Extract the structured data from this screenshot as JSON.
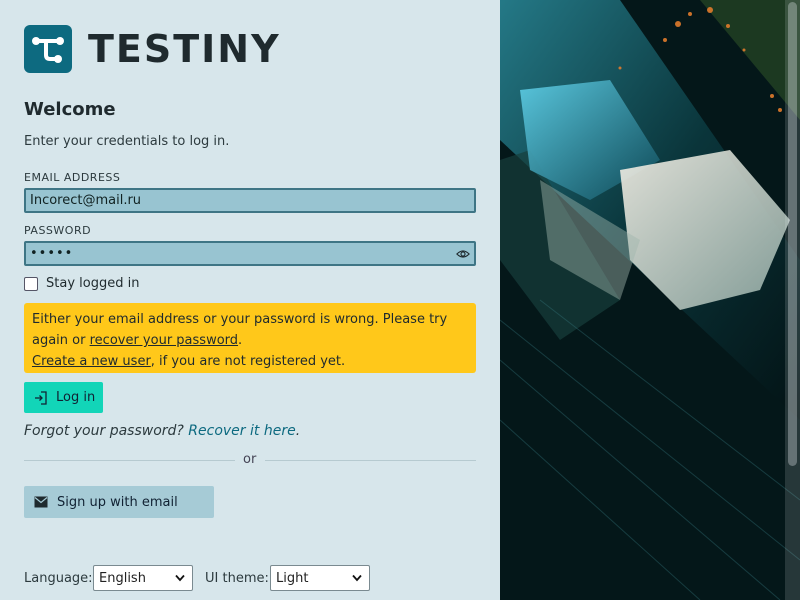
{
  "brand": {
    "name": "TESTINY",
    "logo_color": "#0d6a80"
  },
  "login": {
    "title": "Welcome",
    "subtitle": "Enter your credentials to log in.",
    "email_label": "EMAIL ADDRESS",
    "email_value": "Incorect@mail.ru",
    "password_label": "PASSWORD",
    "password_value": "•••••",
    "stay_logged_in_label": "Stay logged in",
    "stay_logged_in_checked": false
  },
  "error": {
    "text_1": "Either your email address or your password is wrong. Please try again or ",
    "recover_link": "recover your password",
    "text_2": ".",
    "create_link": "Create a new user",
    "text_3": ", if you are not registered yet.",
    "color": "#ffc81a"
  },
  "actions": {
    "login_label": "Log in",
    "login_color": "#12d5b8",
    "forgot_text": "Forgot your password?",
    "recover_link": "Recover it here",
    "recover_suffix": ".",
    "or_label": "or",
    "signup_label": "Sign up with email"
  },
  "footer": {
    "language_label": "Language:",
    "language_value": "English",
    "theme_label": "UI theme:",
    "theme_value": "Light"
  },
  "icons": {
    "logo": "testiny-logo-icon",
    "eye": "eye-icon",
    "login": "login-icon",
    "mail": "mail-icon",
    "chevron": "chevron-down-icon"
  }
}
